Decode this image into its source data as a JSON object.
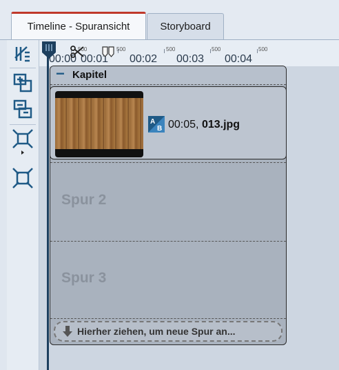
{
  "tabs": [
    {
      "label": "Timeline - Spuransicht",
      "active": true
    },
    {
      "label": "Storyboard",
      "active": false
    }
  ],
  "toolbar": {
    "icons": [
      "split-icon",
      "add-item-icon",
      "remove-item-icon",
      "shrink-icon",
      "expand-icon"
    ]
  },
  "ruler": {
    "small_marks": [
      "500",
      "500",
      "500",
      "500",
      "500"
    ],
    "labels": [
      "00:00",
      "00:01",
      "00:02",
      "00:03",
      "00:04"
    ]
  },
  "chapter": {
    "collapse_symbol": "−",
    "title": "Kapitel",
    "clip": {
      "duration": "00:05,",
      "filename": "013.jpg",
      "transition_badge": "AB"
    },
    "tracks": [
      "Spur 2",
      "Spur 3"
    ],
    "dropzone": "Hierher ziehen, um neue Spur an..."
  },
  "colors": {
    "accent_tab": "#c0392b",
    "icon_blue": "#1f5a86",
    "playhead": "#1d3f5e"
  }
}
